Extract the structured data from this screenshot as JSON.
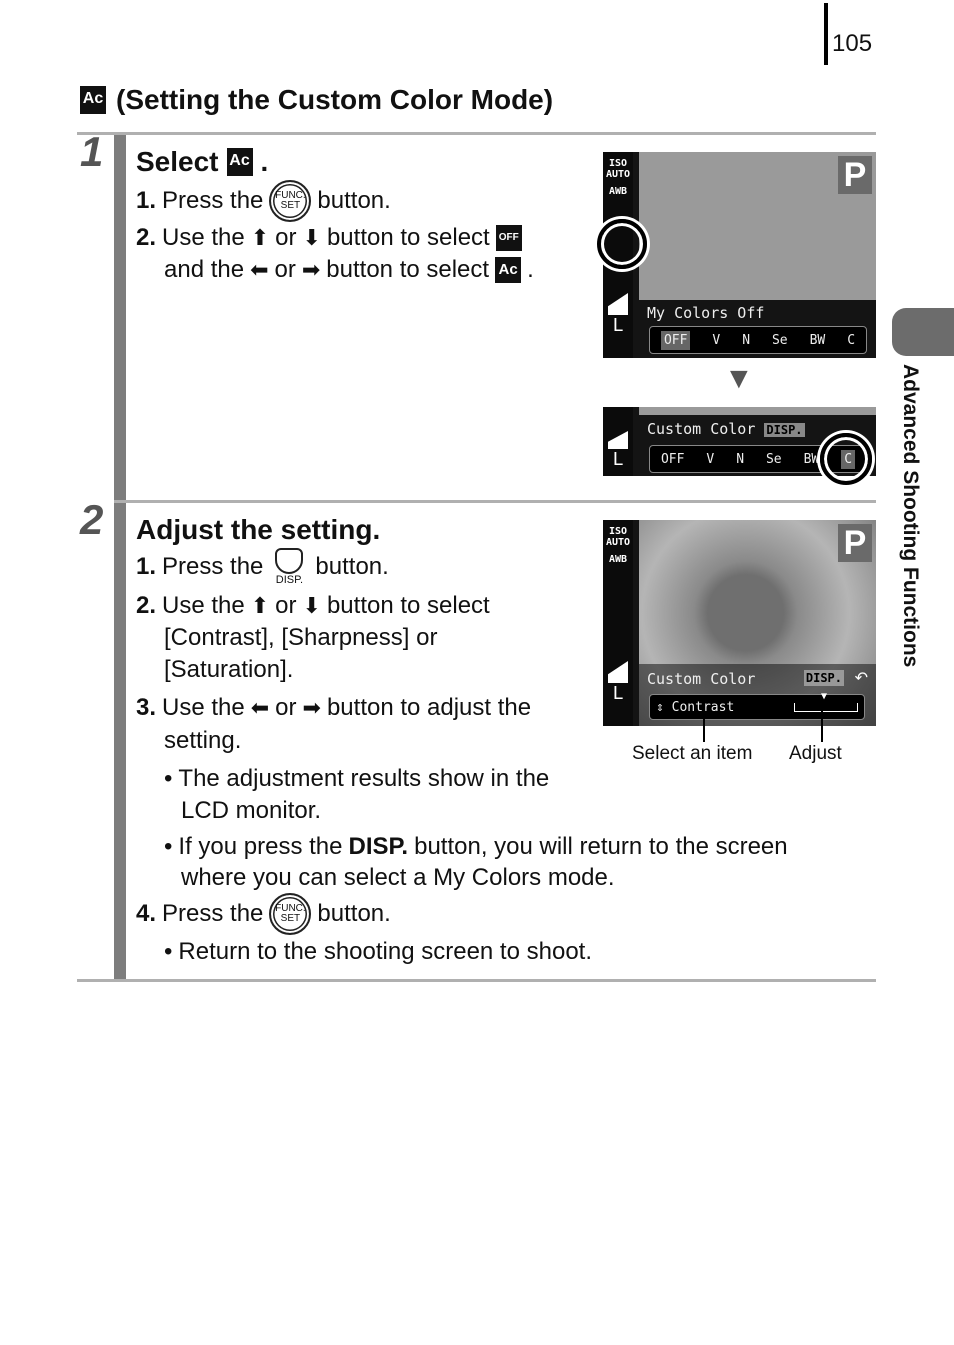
{
  "page": {
    "number": "105",
    "side_tab_label": "Advanced Shooting Functions"
  },
  "section": {
    "icon": "custom-color-icon",
    "icon_text": "Ac",
    "title": "(Setting the Custom Color Mode)"
  },
  "steps": [
    {
      "number": "1",
      "title": "Select",
      "title_icon_text": "Ac",
      "title_suffix": ".",
      "items": [
        {
          "num": "1.",
          "pre": "Press the",
          "button": "FUNC./SET",
          "post": "button."
        },
        {
          "num": "2.",
          "pre": "Use the",
          "arrow1": "up",
          "or": "or",
          "arrow2": "down",
          "mid": "button to select",
          "icon_text": "OFF",
          "line2_pre": "and the",
          "arrow3": "left",
          "or2": "or",
          "arrow4": "right",
          "line2_mid": "button to select",
          "icon2_text": "Ac",
          "line2_end": "."
        }
      ],
      "lcd_top": {
        "side_icons": [
          "ISO AUTO",
          "AWB",
          "frame",
          "OFF",
          "flash-comp",
          "metering",
          "quality",
          "L"
        ],
        "mode": "P",
        "label": "My Colors Off",
        "strip": [
          "OFF",
          "V",
          "N",
          "Se",
          "BW",
          "C"
        ],
        "selected_strip": "OFF"
      },
      "lcd_bottom": {
        "label": "Custom Color",
        "disp_badge": "DISP.",
        "strip": [
          "OFF",
          "V",
          "N",
          "Se",
          "BW",
          "C"
        ],
        "selected_strip": "C"
      },
      "down_arrow": "▼"
    },
    {
      "number": "2",
      "title": "Adjust the setting.",
      "items": [
        {
          "num": "1.",
          "pre": "Press the",
          "button": "DISP.",
          "post": "button."
        },
        {
          "num": "2.",
          "pre": "Use the",
          "or": "or",
          "mid": "button to select",
          "line2": "[Contrast], [Sharpness] or",
          "line3": "[Saturation]."
        },
        {
          "num": "3.",
          "pre": "Use the",
          "or": "or",
          "mid": "button to adjust the",
          "line2": "setting."
        },
        {
          "bullet": "The adjustment results show in the",
          "bullet_line2": "LCD monitor."
        },
        {
          "bullet_pre": "If you press the",
          "bullet_bold": "DISP.",
          "bullet_post": "button, you will return to the screen",
          "bullet_line2": "where you can select a My Colors mode."
        },
        {
          "num": "4.",
          "pre": "Press the",
          "button": "FUNC./SET",
          "post": "button."
        },
        {
          "bullet": "Return to the shooting screen to shoot."
        }
      ],
      "lcd": {
        "mode": "P",
        "label": "Custom Color",
        "disp_badge": "DISP.",
        "item": "Contrast",
        "adjust_level": 0.5
      },
      "captions": {
        "select": "Select an item",
        "adjust": "Adjust"
      }
    }
  ],
  "func_button": {
    "top": "FUNC.",
    "bottom": "SET"
  },
  "disp_button": {
    "label": "DISP."
  }
}
